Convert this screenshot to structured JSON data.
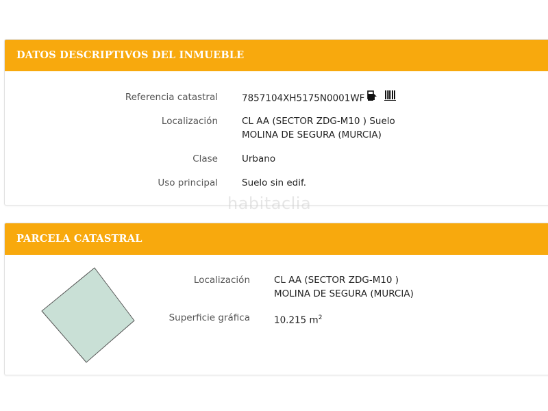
{
  "panel_inmueble": {
    "title": "DATOS DESCRIPTIVOS DEL INMUEBLE",
    "rows": [
      {
        "label": "Referencia catastral",
        "value": "7857104XH5175N0001WF"
      },
      {
        "label": "Localización",
        "value_line1": "CL AA (SECTOR ZDG-M10 ) Suelo",
        "value_line2": "MOLINA DE SEGURA (MURCIA)"
      },
      {
        "label": "Clase",
        "value": "Urbano"
      },
      {
        "label": "Uso principal",
        "value": "Suelo sin edif."
      }
    ]
  },
  "panel_parcela": {
    "title": "PARCELA CATASTRAL",
    "rows": [
      {
        "label": "Localización",
        "value_line1": "CL AA (SECTOR ZDG-M10 )",
        "value_line2": "MOLINA DE SEGURA (MURCIA)"
      },
      {
        "label": "Superficie gráfica",
        "value": "10.215 m",
        "unit_sup": "2"
      }
    ]
  },
  "icons": {
    "copy": "copy-icon",
    "barcode": "barcode-icon"
  },
  "colors": {
    "header_bg": "#f8a90d",
    "parcel_fill": "#c9e0d6",
    "parcel_stroke": "#555555"
  },
  "watermark": "habitaclia"
}
